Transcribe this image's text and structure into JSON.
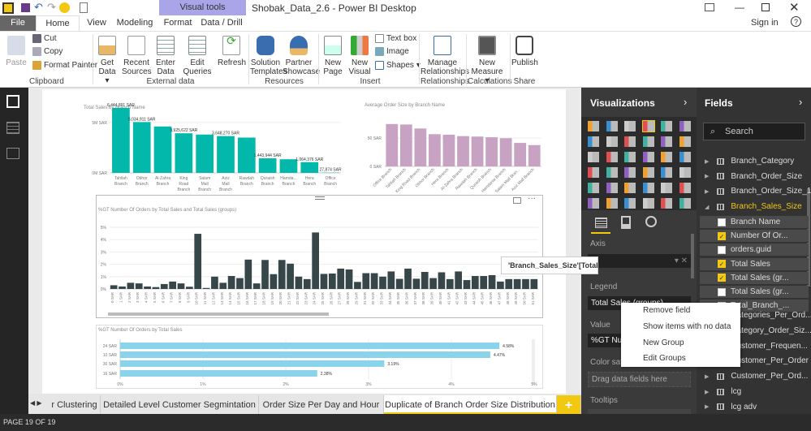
{
  "window": {
    "title": "Shobak_Data_2.6 - Power BI Desktop",
    "contextual_tab": "Visual tools",
    "sign_in": "Sign in"
  },
  "tabs": [
    "File",
    "Home",
    "View",
    "Modeling",
    "Format",
    "Data / Drill"
  ],
  "ribbon": {
    "clipboard": {
      "paste": "Paste",
      "cut": "Cut",
      "copy": "Copy",
      "format_painter": "Format Painter",
      "label": "Clipboard"
    },
    "external": {
      "get_data": "Get Data",
      "recent": "Recent Sources",
      "enter": "Enter Data",
      "edit": "Edit Queries",
      "refresh": "Refresh",
      "label": "External data"
    },
    "resources": {
      "solution": "Solution Templates",
      "partner": "Partner Showcase",
      "label": "Resources"
    },
    "insert": {
      "new_page": "New Page",
      "new_visual": "New Visual",
      "text_box": "Text box",
      "image": "Image",
      "shapes": "Shapes",
      "label": "Insert"
    },
    "relationships": {
      "manage": "Manage Relationships",
      "label": "Relationships"
    },
    "calculations": {
      "new_measure": "New Measure",
      "label": "Calculations"
    },
    "share": {
      "publish": "Publish",
      "label": "Share"
    }
  },
  "chart_data": [
    {
      "type": "bar",
      "title": "Total Sales  by Branch Name",
      "color": "#01b8aa",
      "categories": [
        "Tahliah Branch",
        "Obhor Branch",
        "Al-Zahra Branch",
        "King Road Branch",
        "Salam Mall Branch",
        "Aziz Mall Branch",
        "Rawdah Branch",
        "Quraish Branch",
        "Hamda... Branch",
        "Hera Branch",
        "Office Branch"
      ],
      "values": [
        6444891,
        5034911,
        4600000,
        3925622,
        3800000,
        3648270,
        3500000,
        1443944,
        1350000,
        1064376,
        27874
      ],
      "data_labels": [
        "6,444,891 SAR",
        "5,034,911 SAR",
        "",
        "3,925,622 SAR",
        "",
        "3,648,270 SAR",
        "",
        "1,443,944 SAR",
        "",
        "1,064,376 SAR",
        "27,874 SAR"
      ],
      "yticks": [
        "0M SAR",
        "5M SAR"
      ],
      "ylim": [
        0,
        7000000
      ]
    },
    {
      "type": "bar",
      "title": "Average Order Size by Branch Name",
      "color": "#c8a2c2",
      "categories": [
        "Office Branch",
        "Tahliah Branch",
        "King Road Branch",
        "Obhor Branch",
        "Hera Branch",
        "Al-Zahra Branch",
        "Rawdah Branch",
        "Quraish Branch",
        "Hamdania Branch",
        "Salam Mall Bran...",
        "Aziz Mall Branch"
      ],
      "values": [
        74.6,
        73.7,
        66.7,
        56.7,
        55.8,
        53.3,
        52.5,
        51.3,
        49.6,
        41.3,
        37.5
      ],
      "yticks": [
        "0 SAR",
        "50 SAR"
      ],
      "ylim": [
        0,
        80
      ]
    },
    {
      "type": "bar",
      "title": "%GT Number Of Orders by Total Sales and Total Sales (groups)",
      "color": "#374649",
      "categories": [
        "0 SAR",
        "1 SAR",
        "2 SAR",
        "3 SAR",
        "4 SAR",
        "5 SAR",
        "6 SAR",
        "7 SAR",
        "8 SAR",
        "9 SAR",
        "10 SAR",
        "11 SAR",
        "12 SAR",
        "13 SAR",
        "14 SAR",
        "15 SAR",
        "16 SAR",
        "17 SAR",
        "18 SAR",
        "19 SAR",
        "20 SAR",
        "21 SAR",
        "22 SAR",
        "23 SAR",
        "24 SAR",
        "25 SAR",
        "26 SAR",
        "27 SAR",
        "28 SAR",
        "29 SAR",
        "31 SAR",
        "32 SAR",
        "33 SAR",
        "34 SAR",
        "35 SAR",
        "36 SAR",
        "37 SAR",
        "38 SAR",
        "39 SAR",
        "40 SAR",
        "41 SAR",
        "42 SAR",
        "43 SAR",
        "44 SAR",
        "45 SAR",
        "46 SAR",
        "47 SAR",
        "48 SAR",
        "49 SAR",
        "50 SAR",
        "51 SAR"
      ],
      "values": [
        0.3,
        0.2,
        0.5,
        0.45,
        0.2,
        0.15,
        0.4,
        0.6,
        0.45,
        0.18,
        4.47,
        0.08,
        1.0,
        0.5,
        1.05,
        0.88,
        2.38,
        0.45,
        2.35,
        1.2,
        2.35,
        2.05,
        1.0,
        0.8,
        4.58,
        1.22,
        1.25,
        1.65,
        1.58,
        0.57,
        1.28,
        1.28,
        1.0,
        1.42,
        0.82,
        1.65,
        0.83,
        1.38,
        0.88,
        1.35,
        0.8,
        1.42,
        0.72,
        1.05,
        1.05,
        1.12,
        0.6,
        0.8,
        0.8,
        0.8,
        0.8
      ],
      "yticks": [
        "0%",
        "1%",
        "2%",
        "3%",
        "4%",
        "5%"
      ],
      "ylim": [
        0,
        5
      ]
    },
    {
      "type": "bar",
      "orientation": "horizontal",
      "title": "%GT Number Of Orders by Total Sales",
      "color": "#8ad4eb",
      "categories": [
        "24 SAR",
        "10 SAR",
        "30 SAR",
        "16 SAR"
      ],
      "values": [
        4.58,
        4.47,
        3.19,
        2.38
      ],
      "data_labels": [
        "4.58%",
        "4.47%",
        "3.19%",
        "2.38%"
      ],
      "xticks": [
        "0%",
        "1%",
        "2%",
        "3%",
        "4%",
        "5%"
      ],
      "xlim": [
        0,
        5
      ]
    }
  ],
  "tooltip": "'Branch_Sales_Size'[Total Sales (groups)]",
  "visualizations": {
    "title": "Visualizations",
    "axis_label": "Axis",
    "legend_label": "Legend",
    "legend_value": "Total Sales (groups)",
    "value_label": "Value",
    "value_value": "%GT Number Of Orders",
    "color_sat": "Color saturation",
    "drag": "Drag data fields here",
    "tooltips": "Tooltips"
  },
  "context_menu": [
    "Remove field",
    "Show items with no data",
    "New Group",
    "Edit Groups"
  ],
  "fields": {
    "title": "Fields",
    "search_placeholder": "Search",
    "tables": [
      "Branch_Category",
      "Branch_Order_Size",
      "Branch_Order_Size_1",
      "Branch_Sales_Size"
    ],
    "sub": [
      {
        "label": "Branch Name",
        "checked": false
      },
      {
        "label": "Number Of Or...",
        "checked": true
      },
      {
        "label": "orders.guid",
        "checked": false
      },
      {
        "label": "Total Sales",
        "checked": true
      },
      {
        "label": "Total Sales (gr...",
        "checked": true
      },
      {
        "label": "Total Sales (gr...",
        "checked": false
      },
      {
        "label": "Total_Branch_...",
        "checked": false
      }
    ],
    "more": [
      "Categories_Per_Ord...",
      "Category_Order_Siz...",
      "Customer_Frequen...",
      "Customer_Per_Order",
      "Customer_Per_Ord...",
      "lcg",
      "lcg adv"
    ]
  },
  "page_tabs": [
    "r Clustering",
    "Detailed Level Customer Segmintation",
    "Order Size Per Day and Hour",
    "Duplicate of Branch Order Size Distribution"
  ],
  "status": "PAGE 19 OF 19",
  "colors": {
    "accent": "#f2c811",
    "contextual": "#a9a5e8"
  }
}
